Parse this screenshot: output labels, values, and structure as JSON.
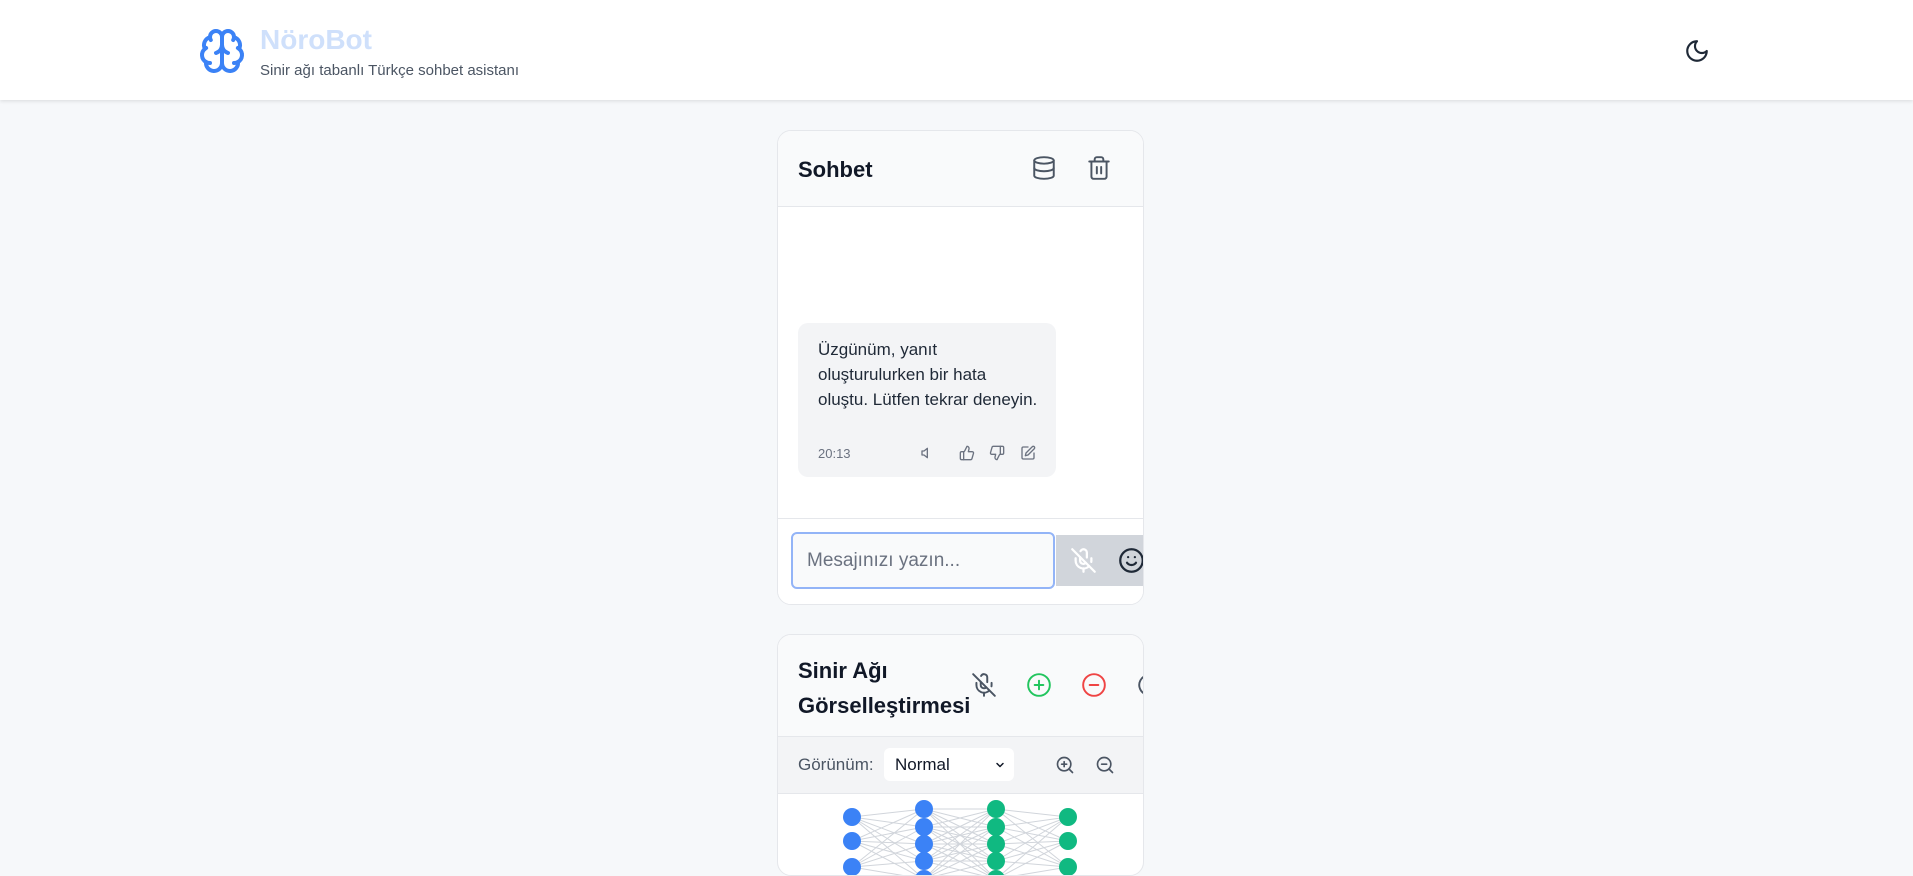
{
  "app": {
    "name": "NöroBot",
    "tagline": "Sinir ağı tabanlı Türkçe sohbet asistanı",
    "brand_color": "#3b82f6",
    "icons": {
      "logo": "brain-icon",
      "theme_toggle": "moon-icon"
    }
  },
  "chat": {
    "title": "Sohbet",
    "header_icons": [
      "database-icon",
      "trash-icon"
    ],
    "messages": [
      {
        "text": "Üzgünüm, yanıt oluşturulurken bir hata oluştu. Lütfen tekrar deneyin.",
        "time": "20:13",
        "actions": [
          "speaker-icon",
          "thumbs-up-icon",
          "thumbs-down-icon",
          "edit-icon"
        ]
      }
    ],
    "input": {
      "placeholder": "Mesajınızı yazın...",
      "value": ""
    },
    "input_icons": [
      "mic-off-icon",
      "smile-icon"
    ]
  },
  "neural_network": {
    "title": "Sinir Ağı Görselleştirmesi",
    "header_icons": [
      "mic-off-icon",
      "plus-circle-icon",
      "minus-circle-icon",
      "refresh-icon"
    ],
    "view_label": "Görünüm:",
    "view_selected": "Normal",
    "zoom_icons": [
      "zoom-in-icon",
      "zoom-out-icon"
    ],
    "layer_colors": [
      "#3b82f6",
      "#3b82f6",
      "#10b981",
      "#10b981"
    ],
    "accent_colors": {
      "add": "#22c55e",
      "remove": "#ef4444"
    }
  }
}
